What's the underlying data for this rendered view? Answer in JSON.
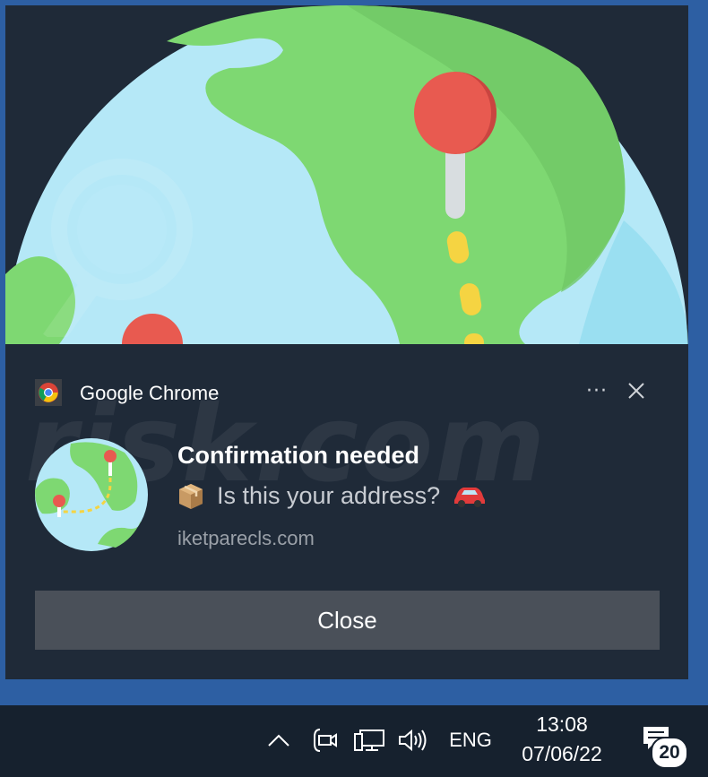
{
  "notification": {
    "app_name": "Google Chrome",
    "more_label": "···",
    "title": "Confirmation needed",
    "message": "Is this your address?",
    "source": "iketparecls.com",
    "close_button": "Close"
  },
  "icons": {
    "app": "chrome-icon",
    "more": "more-options-icon",
    "dismiss": "close-icon",
    "message_prefix": "package-emoji",
    "message_suffix": "car-emoji"
  },
  "taskbar": {
    "language": "ENG",
    "time": "13:08",
    "date": "07/06/22",
    "notification_count": "20",
    "tray_icons": [
      "chevron-up-icon",
      "meet-now-icon",
      "network-icon",
      "volume-icon"
    ]
  },
  "colors": {
    "toast_background": "#1f2a38",
    "close_button": "#4a5059",
    "taskbar": "#16212e",
    "globe_ocean": "#b5e8f7",
    "globe_land": "#7ed872",
    "pin": "#e05050"
  }
}
